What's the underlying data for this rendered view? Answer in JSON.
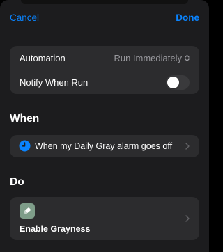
{
  "nav": {
    "cancel_label": "Cancel",
    "done_label": "Done"
  },
  "settings": {
    "automation_label": "Automation",
    "automation_value": "Run Immediately",
    "notify_label": "Notify When Run",
    "notify_on": false
  },
  "when": {
    "title": "When",
    "trigger_label": "When my Daily Gray alarm goes off",
    "trigger_icon": "clock-icon"
  },
  "do": {
    "title": "Do",
    "action_label": "Enable Grayness",
    "action_icon": "eraser-icon",
    "action_icon_color": "#7e9d89"
  },
  "colors": {
    "accent": "#0a84ff",
    "background": "#1c1c1e",
    "card": "#2c2c2e"
  }
}
